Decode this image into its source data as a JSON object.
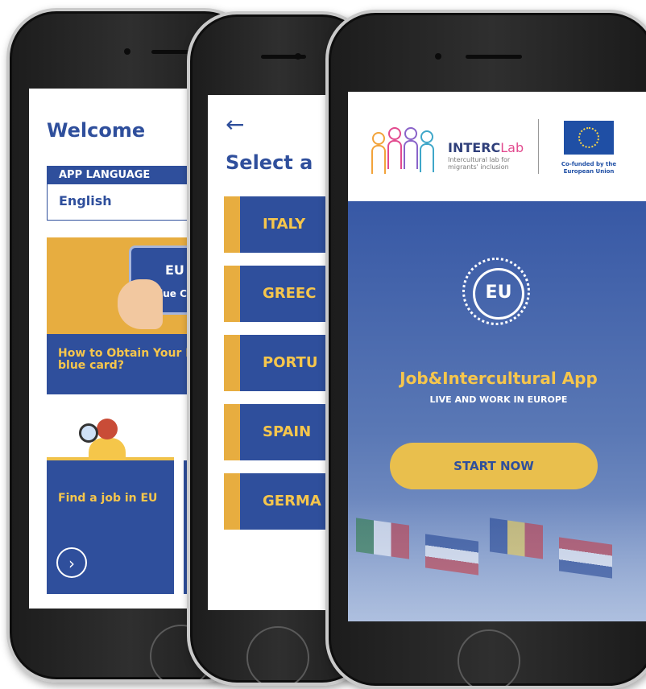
{
  "welcome_screen": {
    "title": "Welcome",
    "language": {
      "label": "APP LANGUAGE",
      "value": "English"
    },
    "blue_card": {
      "card_top": "EU",
      "card_text": "Blue Ca",
      "title": "How to Obtain Your EU blue card?"
    },
    "job_card": {
      "title": "Find a job in EU",
      "arrow": "›"
    }
  },
  "country_screen": {
    "back": "←",
    "title": "Select a",
    "countries": [
      "ITALY",
      "GREEC",
      "PORTU",
      "SPAIN",
      "GERMA"
    ]
  },
  "start_screen": {
    "logo": {
      "inter": "INTERC",
      "lab": "Lab",
      "sub": "Intercultural lab for migrants' inclusion",
      "cofund": "Co-funded by the European Union"
    },
    "badge": "EU",
    "app_title": "Job&Intercultural App",
    "app_subtitle": "LIVE AND WORK IN EUROPE",
    "start_button": "START NOW"
  },
  "colors": {
    "blue": "#2f4f9c",
    "yellow": "#f6c64c",
    "orange": "#e7ad40"
  }
}
